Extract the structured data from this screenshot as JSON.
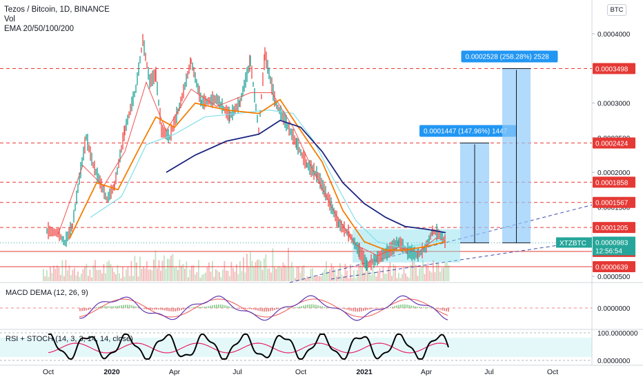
{
  "header": {
    "symbol_line": "Tezos / Bitcoin, 1D, BINANCE",
    "vol_label": "Vol",
    "ema_label": "EMA 20/50/100/200",
    "currency_badge": "BTC"
  },
  "colors": {
    "up": "#26a69a",
    "down": "#ef5350",
    "ema20": "#ef5350",
    "ema50": "#f57c00",
    "ema100": "#80deea",
    "ema200": "#1a237e",
    "measure_box": "#90caf9",
    "measure_label": "#2196f3",
    "resistance": "#e53935",
    "trend": "#3949ab",
    "rsi": "#e91e63",
    "stoch": "#000000"
  },
  "chart_data": {
    "type": "line",
    "x": [
      "Oct",
      "2020",
      "Apr",
      "Jul",
      "Oct",
      "2021",
      "Apr",
      "Jul",
      "Oct"
    ],
    "y_ticks": [
      "0.0004000",
      "0.0003000",
      "0.0002500",
      "0.0002000",
      "0.0001500",
      "0.0000500"
    ],
    "y_range": [
      5e-05,
      0.00042
    ],
    "price_path": [
      {
        "x": "2019-09-29",
        "y": 0.000115
      },
      {
        "x": "2019-10-15",
        "y": 0.000112
      },
      {
        "x": "2019-10-25",
        "y": 9.8e-05
      },
      {
        "x": "2019-11-05",
        "y": 0.000122
      },
      {
        "x": "2019-11-15",
        "y": 0.00019
      },
      {
        "x": "2019-11-25",
        "y": 0.00025
      },
      {
        "x": "2019-12-05",
        "y": 0.00021
      },
      {
        "x": "2019-12-15",
        "y": 0.000185
      },
      {
        "x": "2019-12-25",
        "y": 0.00016
      },
      {
        "x": "2020-01-05",
        "y": 0.00018
      },
      {
        "x": "2020-01-20",
        "y": 0.00026
      },
      {
        "x": "2020-02-05",
        "y": 0.00032
      },
      {
        "x": "2020-02-15",
        "y": 0.00039
      },
      {
        "x": "2020-02-25",
        "y": 0.00033
      },
      {
        "x": "2020-03-05",
        "y": 0.00034
      },
      {
        "x": "2020-03-13",
        "y": 0.00026
      },
      {
        "x": "2020-03-25",
        "y": 0.00025
      },
      {
        "x": "2020-04-10",
        "y": 0.0003
      },
      {
        "x": "2020-04-25",
        "y": 0.00036
      },
      {
        "x": "2020-05-10",
        "y": 0.0003
      },
      {
        "x": "2020-06-01",
        "y": 0.000305
      },
      {
        "x": "2020-06-20",
        "y": 0.00028
      },
      {
        "x": "2020-07-05",
        "y": 0.0003
      },
      {
        "x": "2020-07-20",
        "y": 0.00036
      },
      {
        "x": "2020-08-01",
        "y": 0.00026
      },
      {
        "x": "2020-08-10",
        "y": 0.00037
      },
      {
        "x": "2020-08-25",
        "y": 0.0003
      },
      {
        "x": "2020-09-10",
        "y": 0.00027
      },
      {
        "x": "2020-09-25",
        "y": 0.00024
      },
      {
        "x": "2020-10-10",
        "y": 0.00021
      },
      {
        "x": "2020-10-25",
        "y": 0.000195
      },
      {
        "x": "2020-11-10",
        "y": 0.00016
      },
      {
        "x": "2020-11-25",
        "y": 0.000125
      },
      {
        "x": "2020-12-10",
        "y": 0.00011
      },
      {
        "x": "2020-12-25",
        "y": 8.5e-05
      },
      {
        "x": "2021-01-05",
        "y": 6.5e-05
      },
      {
        "x": "2021-01-20",
        "y": 7.5e-05
      },
      {
        "x": "2021-02-05",
        "y": 8.5e-05
      },
      {
        "x": "2021-02-20",
        "y": 9.8e-05
      },
      {
        "x": "2021-03-05",
        "y": 8.5e-05
      },
      {
        "x": "2021-03-20",
        "y": 8e-05
      },
      {
        "x": "2021-04-01",
        "y": 9.2e-05
      },
      {
        "x": "2021-04-10",
        "y": 0.000115
      },
      {
        "x": "2021-04-20",
        "y": 0.00011
      },
      {
        "x": "2021-04-29",
        "y": 9.83e-05
      }
    ],
    "ema200_path": [
      {
        "x": "2020-03-20",
        "y": 0.0002
      },
      {
        "x": "2020-05-01",
        "y": 0.000225
      },
      {
        "x": "2020-06-15",
        "y": 0.000245
      },
      {
        "x": "2020-08-01",
        "y": 0.000255
      },
      {
        "x": "2020-09-01",
        "y": 0.000275
      },
      {
        "x": "2020-10-01",
        "y": 0.000265
      },
      {
        "x": "2020-11-01",
        "y": 0.00023
      },
      {
        "x": "2020-12-01",
        "y": 0.000185
      },
      {
        "x": "2021-01-01",
        "y": 0.000155
      },
      {
        "x": "2021-02-01",
        "y": 0.000135
      },
      {
        "x": "2021-03-01",
        "y": 0.000122
      },
      {
        "x": "2021-04-01",
        "y": 0.000118
      },
      {
        "x": "2021-04-29",
        "y": 0.000113
      }
    ],
    "ema50_path": [
      {
        "x": "2019-11-01",
        "y": 0.000105
      },
      {
        "x": "2019-12-10",
        "y": 0.000185
      },
      {
        "x": "2020-01-10",
        "y": 0.000175
      },
      {
        "x": "2020-02-10",
        "y": 0.000235
      },
      {
        "x": "2020-03-05",
        "y": 0.00028
      },
      {
        "x": "2020-04-01",
        "y": 0.000265
      },
      {
        "x": "2020-05-01",
        "y": 0.0003
      },
      {
        "x": "2020-06-15",
        "y": 0.00029
      },
      {
        "x": "2020-08-01",
        "y": 0.000285
      },
      {
        "x": "2020-09-01",
        "y": 0.000305
      },
      {
        "x": "2020-10-01",
        "y": 0.00026
      },
      {
        "x": "2020-11-01",
        "y": 0.000215
      },
      {
        "x": "2020-12-01",
        "y": 0.000145
      },
      {
        "x": "2021-01-01",
        "y": 0.0001
      },
      {
        "x": "2021-02-01",
        "y": 8.8e-05
      },
      {
        "x": "2021-03-01",
        "y": 8.8e-05
      },
      {
        "x": "2021-04-01",
        "y": 9.3e-05
      },
      {
        "x": "2021-04-29",
        "y": 0.0001
      }
    ],
    "ema20_path": [
      {
        "x": "2019-10-15",
        "y": 0.00011
      },
      {
        "x": "2019-11-20",
        "y": 0.00021
      },
      {
        "x": "2019-12-20",
        "y": 0.00018
      },
      {
        "x": "2020-01-20",
        "y": 0.00023
      },
      {
        "x": "2020-02-20",
        "y": 0.00033
      },
      {
        "x": "2020-03-20",
        "y": 0.00026
      },
      {
        "x": "2020-04-25",
        "y": 0.00032
      },
      {
        "x": "2020-06-01",
        "y": 0.000295
      },
      {
        "x": "2020-07-20",
        "y": 0.000315
      },
      {
        "x": "2020-08-20",
        "y": 0.000315
      },
      {
        "x": "2020-09-20",
        "y": 0.000265
      },
      {
        "x": "2020-10-20",
        "y": 0.0002
      },
      {
        "x": "2020-11-20",
        "y": 0.00014
      },
      {
        "x": "2020-12-20",
        "y": 9.5e-05
      },
      {
        "x": "2021-01-20",
        "y": 8e-05
      },
      {
        "x": "2021-02-20",
        "y": 9.2e-05
      },
      {
        "x": "2021-03-20",
        "y": 8.5e-05
      },
      {
        "x": "2021-04-15",
        "y": 0.000105
      },
      {
        "x": "2021-04-29",
        "y": 0.000102
      }
    ],
    "ema100_path": [
      {
        "x": "2019-12-01",
        "y": 0.000135
      },
      {
        "x": "2020-01-15",
        "y": 0.000165
      },
      {
        "x": "2020-02-20",
        "y": 0.00024
      },
      {
        "x": "2020-04-01",
        "y": 0.000255
      },
      {
        "x": "2020-05-15",
        "y": 0.00028
      },
      {
        "x": "2020-07-01",
        "y": 0.000285
      },
      {
        "x": "2020-08-15",
        "y": 0.00029
      },
      {
        "x": "2020-09-20",
        "y": 0.000285
      },
      {
        "x": "2020-10-20",
        "y": 0.000245
      },
      {
        "x": "2020-11-20",
        "y": 0.000185
      },
      {
        "x": "2020-12-20",
        "y": 0.00013
      },
      {
        "x": "2021-01-20",
        "y": 0.0001
      },
      {
        "x": "2021-02-20",
        "y": 9.2e-05
      },
      {
        "x": "2021-03-20",
        "y": 9.5e-05
      },
      {
        "x": "2021-04-29",
        "y": 0.000103
      }
    ],
    "price_levels": [
      {
        "value": 0.0003498,
        "label": "0.0003498",
        "style": "dashed"
      },
      {
        "value": 0.0002424,
        "label": "0.0002424",
        "style": "dashed"
      },
      {
        "value": 0.0001858,
        "label": "0.0001858",
        "style": "dashed"
      },
      {
        "value": 0.0001567,
        "label": "0.0001567",
        "style": "dashed"
      },
      {
        "value": 0.0001205,
        "label": "0.0001205",
        "style": "dashed"
      },
      {
        "value": 8.59e-05,
        "label": "0.0000859",
        "style": "solid"
      },
      {
        "value": 6.39e-05,
        "label": "0.0000639",
        "style": "solid"
      }
    ],
    "measurements": [
      {
        "label": "0.0001447 (147.96%) 1447",
        "from": 9.83e-05,
        "to": 0.0002424,
        "x_start": "2021-05-20",
        "x_end": "2021-07-01"
      },
      {
        "label": "0.0002528 (258.28%) 2528",
        "from": 9.83e-05,
        "to": 0.0003498,
        "x_start": "2021-07-20",
        "x_end": "2021-08-30"
      }
    ],
    "current": {
      "symbol": "XTZBTC",
      "price": "0.0000983",
      "countdown": "12:56:54"
    },
    "macd": {
      "label": "MACD DEMA (12, 26, 9)",
      "tick": "0.0000000"
    },
    "rsi": {
      "label": "RSI + STOCH (14, 3, 3, 14, 14, close)",
      "ticks": [
        "100.0000000",
        "0.0000000"
      ]
    }
  }
}
